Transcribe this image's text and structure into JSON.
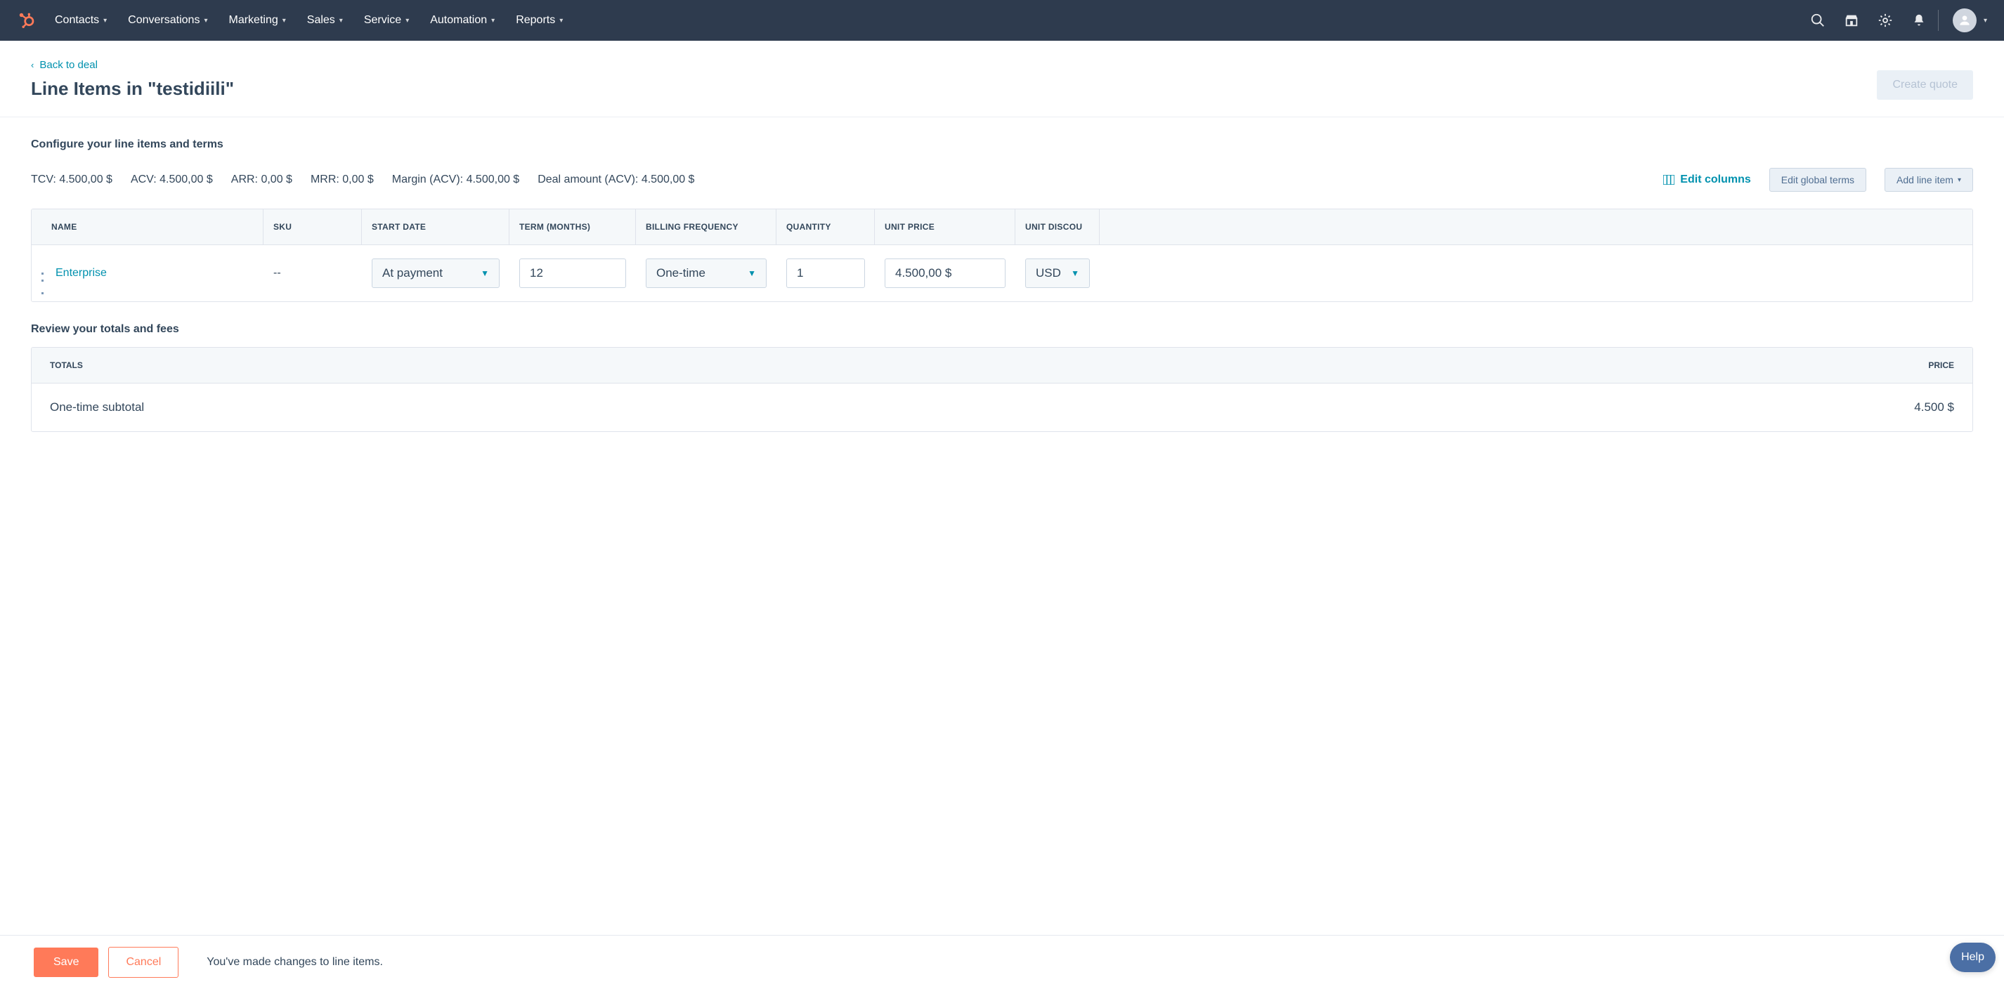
{
  "nav": {
    "items": [
      "Contacts",
      "Conversations",
      "Marketing",
      "Sales",
      "Service",
      "Automation",
      "Reports"
    ]
  },
  "back_link": "Back to deal",
  "page_title": "Line Items in \"testidiili\"",
  "create_quote": "Create quote",
  "section_configure": "Configure your line items and terms",
  "summary": {
    "tcv_label": "TCV:",
    "tcv_value": "4.500,00 $",
    "acv_label": "ACV:",
    "acv_value": "4.500,00 $",
    "arr_label": "ARR:",
    "arr_value": "0,00 $",
    "mrr_label": "MRR:",
    "mrr_value": "0,00 $",
    "margin_label": "Margin (ACV):",
    "margin_value": "4.500,00 $",
    "deal_label": "Deal amount (ACV):",
    "deal_value": "4.500,00 $"
  },
  "actions": {
    "edit_columns": "Edit columns",
    "edit_global": "Edit global terms",
    "add_line_item": "Add line item"
  },
  "table": {
    "headers": [
      "NAME",
      "SKU",
      "START DATE",
      "TERM (MONTHS)",
      "BILLING FREQUENCY",
      "QUANTITY",
      "UNIT PRICE",
      "UNIT DISCOU"
    ],
    "rows": [
      {
        "name": "Enterprise",
        "sku": "--",
        "start_date": "At payment",
        "term": "12",
        "billing": "One-time",
        "quantity": "1",
        "unit_price": "4.500,00 $",
        "discount_currency": "USD"
      }
    ]
  },
  "section_review": "Review your totals and fees",
  "totals": {
    "header_left": "TOTALS",
    "header_right": "PRICE",
    "rows": [
      {
        "label": "One-time subtotal",
        "price": "4.500 $"
      }
    ]
  },
  "footer": {
    "save": "Save",
    "cancel": "Cancel",
    "message": "You've made changes to line items."
  },
  "help": "Help"
}
